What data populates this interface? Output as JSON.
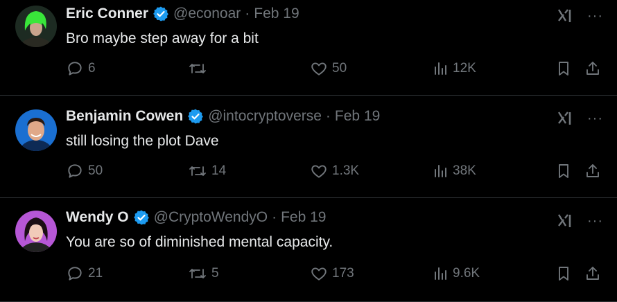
{
  "tweets": [
    {
      "name": "Eric Conner",
      "handle": "@econoar",
      "separator": "·",
      "date": "Feb 19",
      "text": "Bro maybe step away for a bit",
      "replies": "6",
      "retweets": "",
      "likes": "50",
      "views": "12K",
      "avatar_colors": {
        "bg": "#1d2b22",
        "hair": "#39e63a",
        "skin": "#c9a48d"
      }
    },
    {
      "name": "Benjamin Cowen",
      "handle": "@intocryptoverse",
      "separator": "·",
      "date": "Feb 19",
      "text": "still losing the plot Dave",
      "replies": "50",
      "retweets": "14",
      "likes": "1.3K",
      "views": "38K",
      "avatar_colors": {
        "bg": "#1a6fd1",
        "hair": "#2b1a12",
        "skin": "#e0a888"
      }
    },
    {
      "name": "Wendy O",
      "handle": "@CryptoWendyO",
      "separator": "·",
      "date": "Feb 19",
      "text": "You are so of diminished mental capacity.",
      "replies": "21",
      "retweets": "5",
      "likes": "173",
      "views": "9.6K",
      "avatar_colors": {
        "bg": "#b657d6",
        "hair": "#1b0f14",
        "skin": "#f1cbb9"
      }
    }
  ],
  "colors": {
    "background": "#000000",
    "text": "#e7e9ea",
    "muted": "#71767b",
    "verified": "#1d9bf0",
    "divider": "#2f3336"
  },
  "icons": {
    "reply": "speech-bubble-icon",
    "retweet": "retweet-icon",
    "like": "heart-icon",
    "views": "bar-chart-icon",
    "bookmark": "bookmark-icon",
    "share": "share-icon",
    "grok": "grok-icon",
    "more": "more-dots-icon",
    "verified": "verified-badge-icon"
  },
  "more_label": "···"
}
